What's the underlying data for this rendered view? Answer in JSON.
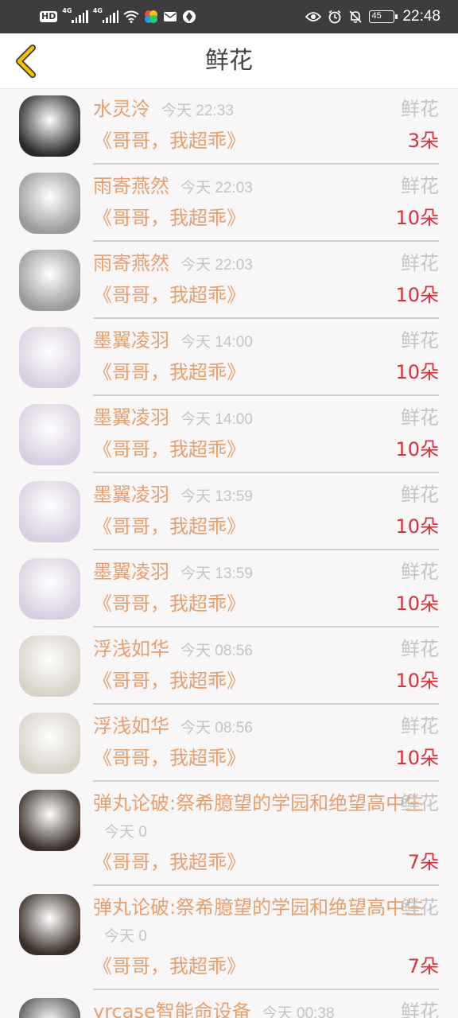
{
  "status_bar": {
    "network_label": "HD",
    "sim1_gen": "4G",
    "sim2_gen": "4G",
    "battery_level": "45",
    "time": "22:48"
  },
  "header": {
    "title": "鲜花",
    "back_icon": "chevron-left-icon"
  },
  "records": [
    {
      "user": "水灵泠",
      "time": "今天 22:33",
      "gift": "鲜花",
      "book": "《哥哥，我超乖》",
      "count": "3朵",
      "avatar_color": "#2a2a2a"
    },
    {
      "user": "雨寄燕然",
      "time": "今天 22:03",
      "gift": "鲜花",
      "book": "《哥哥，我超乖》",
      "count": "10朵",
      "avatar_color": "#9a9a9a"
    },
    {
      "user": "雨寄燕然",
      "time": "今天 22:03",
      "gift": "鲜花",
      "book": "《哥哥，我超乖》",
      "count": "10朵",
      "avatar_color": "#9a9a9a"
    },
    {
      "user": "墨翼凌羽",
      "time": "今天 14:00",
      "gift": "鲜花",
      "book": "《哥哥，我超乖》",
      "count": "10朵",
      "avatar_color": "#d9cfe0"
    },
    {
      "user": "墨翼凌羽",
      "time": "今天 14:00",
      "gift": "鲜花",
      "book": "《哥哥，我超乖》",
      "count": "10朵",
      "avatar_color": "#d9cfe0"
    },
    {
      "user": "墨翼凌羽",
      "time": "今天 13:59",
      "gift": "鲜花",
      "book": "《哥哥，我超乖》",
      "count": "10朵",
      "avatar_color": "#d9cfe0"
    },
    {
      "user": "墨翼凌羽",
      "time": "今天 13:59",
      "gift": "鲜花",
      "book": "《哥哥，我超乖》",
      "count": "10朵",
      "avatar_color": "#d9cfe0"
    },
    {
      "user": "浮浅如华",
      "time": "今天 08:56",
      "gift": "鲜花",
      "book": "《哥哥，我超乖》",
      "count": "10朵",
      "avatar_color": "#d8d2c8"
    },
    {
      "user": "浮浅如华",
      "time": "今天 08:56",
      "gift": "鲜花",
      "book": "《哥哥，我超乖》",
      "count": "10朵",
      "avatar_color": "#d8d2c8"
    },
    {
      "user": "弹丸论破:祭希臆望的学园和绝望高中生",
      "time": "今天 0",
      "gift": "鲜花",
      "book": "《哥哥，我超乖》",
      "count": "7朵",
      "avatar_color": "#3a2e28"
    },
    {
      "user": "弹丸论破:祭希臆望的学园和绝望高中生",
      "time": "今天 0",
      "gift": "鲜花",
      "book": "《哥哥，我超乖》",
      "count": "7朵",
      "avatar_color": "#3a2e28"
    },
    {
      "user": "yrcase智能命设备",
      "time": "今天 00:38",
      "gift": "鲜花",
      "book": "",
      "count": "",
      "avatar_color": "#555555"
    }
  ],
  "colors": {
    "username": "#e5a070",
    "count": "#d4323c",
    "muted": "#c4c4c4",
    "status_bar_bg": "#3d3d3d",
    "back_icon": "#f2c200"
  }
}
